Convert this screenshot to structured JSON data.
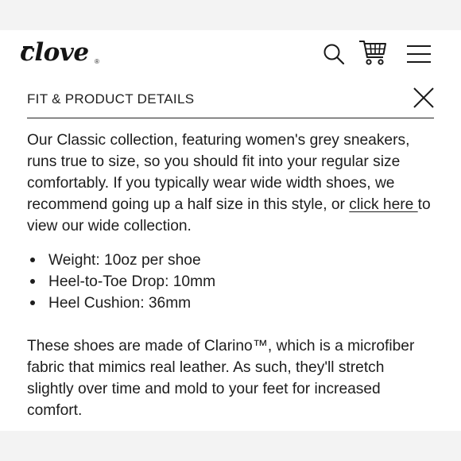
{
  "header": {
    "logo_text": "clove",
    "logo_reg": "®",
    "icons": [
      "search-icon",
      "cart-icon",
      "menu-icon"
    ]
  },
  "section": {
    "title": "FIT & PRODUCT DETAILS",
    "close_icon": "close-icon"
  },
  "description": {
    "text_before_link": "Our Classic collection, featuring women's grey sneakers, runs true to size, so you should fit into your regular size comfortably. If you typically wear wide width shoes, we recommend going up a half size in this style, or ",
    "link_text": "click here ",
    "text_after_link": "to view our wide collection."
  },
  "specs": [
    {
      "label": "Weight: 10oz per shoe"
    },
    {
      "label": "Heel-to-Toe Drop: 10mm"
    },
    {
      "label": "Heel Cushion: 36mm"
    }
  ],
  "material": {
    "text": "These shoes are made of Clarino™, which is a microfiber fabric that mimics real leather. As such, they'll stretch slightly over time and mold to your feet for increased comfort."
  }
}
